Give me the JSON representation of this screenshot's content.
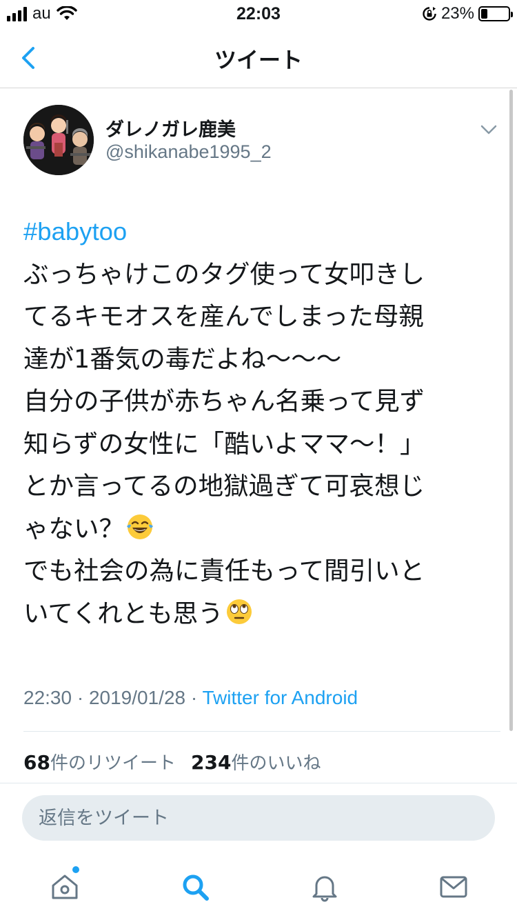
{
  "status_bar": {
    "carrier": "au",
    "time": "22:03",
    "battery_percent": "23%",
    "battery_level": 0.23
  },
  "nav": {
    "title": "ツイート",
    "back_icon": "chevron-left-icon"
  },
  "tweet": {
    "display_name": "ダレノガレ鹿美",
    "handle": "@shikanabe1995_2",
    "hashtag": "#babytoo",
    "lines": [
      "ぶっちゃけこのタグ使って女叩きし",
      "てるキモオスを産んでしまった母親",
      "達が1番気の毒だよね〜〜〜",
      "自分の子供が赤ちゃん名乗って見ず",
      "知らずの女性に「酷いよママ〜！」",
      "とか言ってるの地獄過ぎて可哀想じ",
      "ゃない？",
      "でも社会の為に責任もって間引いと",
      "いてくれとも思う"
    ],
    "emoji_1": "tears-of-joy-emoji",
    "emoji_2": "eye-roll-emoji",
    "time": "22:30 · 2019/01/28 · ",
    "source": "Twitter for Android",
    "retweet_count": "68",
    "retweet_label": "件のリツイート",
    "like_count": "234",
    "like_label": "件のいいね"
  },
  "reply": {
    "placeholder": "返信をツイート"
  },
  "tab_bar": {
    "tabs": [
      "home-icon",
      "search-icon",
      "notifications-icon",
      "messages-icon"
    ],
    "active_color": "#1da1f2",
    "inactive_color": "#657786"
  }
}
